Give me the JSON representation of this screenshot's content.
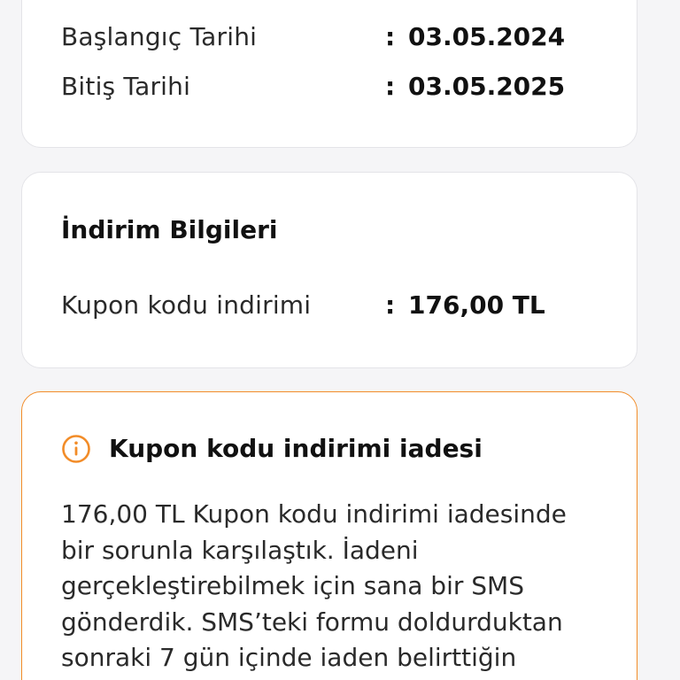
{
  "subscription_dates": {
    "start_label": "Başlangıç Tarihi",
    "start_value": "03.05.2024",
    "end_label": "Bitiş Tarihi",
    "end_value": "03.05.2025",
    "separator": ":"
  },
  "discount_info": {
    "title": "İndirim Bilgileri",
    "coupon_label": "Kupon kodu indirimi",
    "coupon_value": "176,00 TL",
    "separator": ":"
  },
  "refund_alert": {
    "icon": "info-circle-icon",
    "accent_color": "#f28c28",
    "title": "Kupon kodu indirimi iadesi",
    "lines": [
      "176,00 TL Kupon kodu indirimi iadesinde",
      "bir sorunla karşılaştık. İadeni",
      "gerçekleştirebilmek için sana bir SMS",
      "gönderdik. SMS’teki formu doldurduktan",
      "sonraki 7 gün içinde iaden belirttiğin"
    ]
  }
}
